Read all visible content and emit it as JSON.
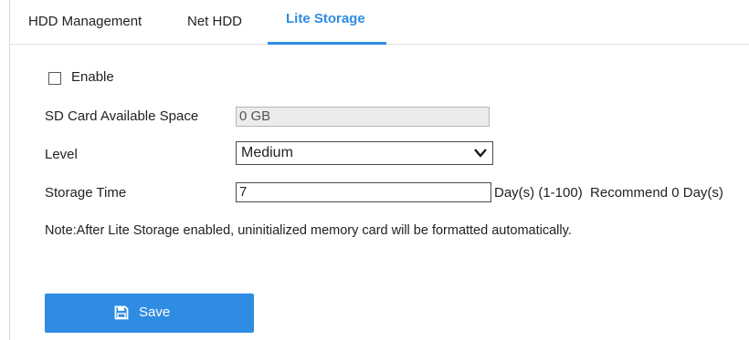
{
  "tabs": [
    {
      "label": "HDD Management"
    },
    {
      "label": "Net HDD"
    },
    {
      "label": "Lite Storage"
    }
  ],
  "form": {
    "enable_label": "Enable",
    "enable_checked": false,
    "sd_space_label": "SD Card Available Space",
    "sd_space_value": "0 GB",
    "level_label": "Level",
    "level_value": "Medium",
    "storage_time_label": "Storage Time",
    "storage_time_value": "7",
    "storage_time_hint": "Day(s) (1-100)  Recommend 0 Day(s)",
    "note": "Note:After Lite Storage enabled, uninitialized memory card will be formatted automatically."
  },
  "save": {
    "label": "Save"
  },
  "colors": {
    "accent": "#2f8ce3"
  }
}
